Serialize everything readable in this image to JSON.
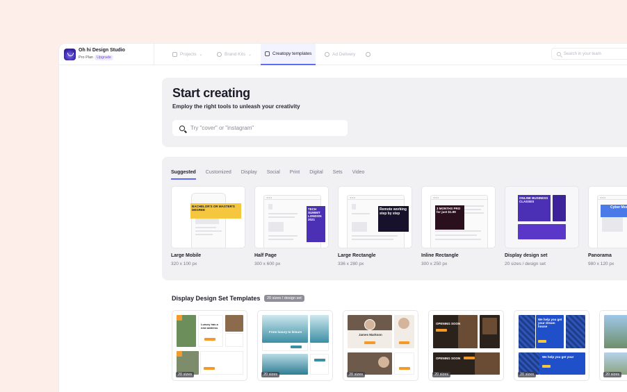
{
  "app": {
    "workspace_name": "Oh hi Design Studio",
    "plan": "Pro Plan",
    "upgrade_label": "Upgrade"
  },
  "nav": {
    "items": [
      {
        "label": "Projects",
        "icon": "folder-icon"
      },
      {
        "label": "Brand Kits",
        "icon": "palette-icon"
      },
      {
        "label": "Creatopy templates",
        "icon": "template-icon"
      },
      {
        "label": "Ad Delivery",
        "icon": "cloud-icon"
      }
    ],
    "active": "Creatopy templates",
    "search_placeholder": "Search in your team"
  },
  "hero": {
    "title": "Start creating",
    "subtitle": "Employ the right tools to unleash your creativity",
    "search_placeholder": "Try \"cover\" or \"instagram\""
  },
  "tabs": [
    "Suggested",
    "Customized",
    "Display",
    "Social",
    "Print",
    "Digital",
    "Sets",
    "Video"
  ],
  "active_tab": "Suggested",
  "formats": [
    {
      "name": "Large Mobile",
      "size": "320 x 100 px",
      "ad_text": "BACHELOR'S OR MASTER'S DEGREE"
    },
    {
      "name": "Half Page",
      "size": "300 x 600 px",
      "ad_text": "TECH SUMMIT LONDON 2021"
    },
    {
      "name": "Large Rectangle",
      "size": "336 x 280 px",
      "ad_text": "Remote working step by step"
    },
    {
      "name": "Inline Rectangle",
      "size": "300 x 250 px",
      "ad_text": "3 MONTHS PRO for just $1.99"
    },
    {
      "name": "Display design set",
      "size": "20 sizes / design set",
      "ad_text": "ONLINE BUSINESS CLASSES"
    },
    {
      "name": "Panorama",
      "size": "980 x 120 px",
      "ad_text": "Cyber Monday"
    }
  ],
  "templates_section": {
    "title": "Display Design Set Templates",
    "badge": "20 sizes / design set",
    "items": [
      {
        "count": "20 sizes",
        "headline": "Luxury has a new address"
      },
      {
        "count": "20 sizes",
        "headline": "From luxury to leisure"
      },
      {
        "count": "20 sizes",
        "headline": "James Markson"
      },
      {
        "count": "20 sizes",
        "headline": "OPENING SOON"
      },
      {
        "count": "20 sizes",
        "headline": "We help you get your dream house"
      },
      {
        "count": "20 sizes",
        "headline": ""
      }
    ]
  },
  "colors": {
    "accent": "#5b6cf5",
    "page_bg": "#fdeee9",
    "panel_bg": "#f1f1f3"
  }
}
